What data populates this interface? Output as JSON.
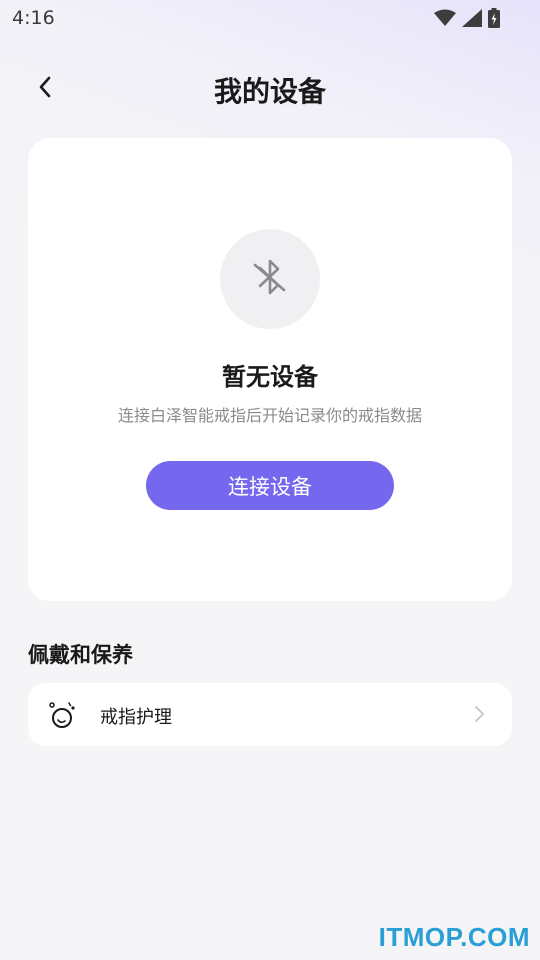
{
  "status_bar": {
    "time": "4:16"
  },
  "header": {
    "title": "我的设备"
  },
  "device_card": {
    "empty_title": "暂无设备",
    "empty_desc": "连接白泽智能戒指后开始记录你的戒指数据",
    "connect_button": "连接设备"
  },
  "care_section": {
    "title": "佩戴和保养",
    "items": [
      {
        "label": "戒指护理"
      }
    ]
  },
  "watermark": "ITMOP.COM",
  "colors": {
    "accent": "#7568ee",
    "card_bg": "#ffffff",
    "page_bg": "#f5f5f7"
  }
}
